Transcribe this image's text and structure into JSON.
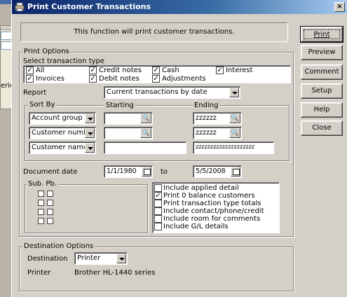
{
  "background": {
    "fragment_text": "erie"
  },
  "dialog": {
    "title": "Print Customer Transactions",
    "close_glyph": "×",
    "banner": "This function will print customer transactions."
  },
  "buttons": {
    "print": "Print",
    "preview": "Preview",
    "comment": "Comment",
    "setup": "Setup",
    "help": "Help",
    "close": "Close"
  },
  "print_options": {
    "group_label": "Print Options",
    "select_type_label": "Select transaction type",
    "types": [
      {
        "label": "All",
        "checked": true
      },
      {
        "label": "Credit notes",
        "checked": true
      },
      {
        "label": "Cash",
        "checked": true
      },
      {
        "label": "Interest",
        "checked": true
      },
      {
        "label": "Invoices",
        "checked": true
      },
      {
        "label": "Debit notes",
        "checked": true
      },
      {
        "label": "Adjustments",
        "checked": true
      }
    ],
    "report_label": "Report",
    "report_value": "Current transactions by date",
    "sort_by_label": "Sort By",
    "starting_label": "Starting",
    "ending_label": "Ending",
    "sort_rows": [
      {
        "field": "Account group",
        "starting": "",
        "ending": "zzzzzz"
      },
      {
        "field": "Customer number",
        "starting": "",
        "ending": "zzzzzz"
      },
      {
        "field": "Customer name",
        "starting": "",
        "ending": "zzzzzzzzzzzzzzzzzzzz"
      }
    ],
    "document_date_label": "Document date",
    "date_from": "1/1/1980",
    "to_label": "to",
    "date_to": "5/5/2008",
    "sub_label": "Sub.",
    "pb_label": "Pb.",
    "includes": [
      {
        "label": "Include applied detail",
        "checked": false
      },
      {
        "label": "Print 0 balance customers",
        "checked": true
      },
      {
        "label": "Print transaction type totals",
        "checked": false
      },
      {
        "label": "Include contact/phone/credit",
        "checked": false
      },
      {
        "label": "Include room for comments",
        "checked": false
      },
      {
        "label": "Include G/L details",
        "checked": false
      }
    ]
  },
  "destination": {
    "group_label": "Destination Options",
    "destination_label": "Destination",
    "destination_value": "Printer",
    "printer_label": "Printer",
    "printer_value": "Brother HL-1440 series"
  },
  "colors": {
    "title_bar": "#0a246a",
    "face": "#d4d0c8"
  }
}
